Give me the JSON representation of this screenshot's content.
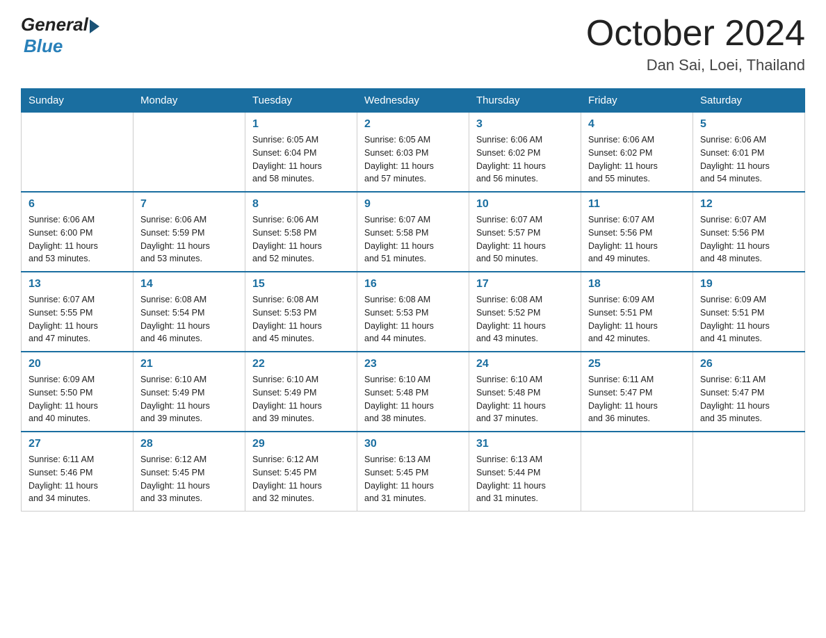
{
  "header": {
    "logo": {
      "general": "General",
      "blue": "Blue"
    },
    "title": "October 2024",
    "subtitle": "Dan Sai, Loei, Thailand"
  },
  "weekdays": [
    "Sunday",
    "Monday",
    "Tuesday",
    "Wednesday",
    "Thursday",
    "Friday",
    "Saturday"
  ],
  "weeks": [
    [
      {
        "day": "",
        "info": ""
      },
      {
        "day": "",
        "info": ""
      },
      {
        "day": "1",
        "info": "Sunrise: 6:05 AM\nSunset: 6:04 PM\nDaylight: 11 hours\nand 58 minutes."
      },
      {
        "day": "2",
        "info": "Sunrise: 6:05 AM\nSunset: 6:03 PM\nDaylight: 11 hours\nand 57 minutes."
      },
      {
        "day": "3",
        "info": "Sunrise: 6:06 AM\nSunset: 6:02 PM\nDaylight: 11 hours\nand 56 minutes."
      },
      {
        "day": "4",
        "info": "Sunrise: 6:06 AM\nSunset: 6:02 PM\nDaylight: 11 hours\nand 55 minutes."
      },
      {
        "day": "5",
        "info": "Sunrise: 6:06 AM\nSunset: 6:01 PM\nDaylight: 11 hours\nand 54 minutes."
      }
    ],
    [
      {
        "day": "6",
        "info": "Sunrise: 6:06 AM\nSunset: 6:00 PM\nDaylight: 11 hours\nand 53 minutes."
      },
      {
        "day": "7",
        "info": "Sunrise: 6:06 AM\nSunset: 5:59 PM\nDaylight: 11 hours\nand 53 minutes."
      },
      {
        "day": "8",
        "info": "Sunrise: 6:06 AM\nSunset: 5:58 PM\nDaylight: 11 hours\nand 52 minutes."
      },
      {
        "day": "9",
        "info": "Sunrise: 6:07 AM\nSunset: 5:58 PM\nDaylight: 11 hours\nand 51 minutes."
      },
      {
        "day": "10",
        "info": "Sunrise: 6:07 AM\nSunset: 5:57 PM\nDaylight: 11 hours\nand 50 minutes."
      },
      {
        "day": "11",
        "info": "Sunrise: 6:07 AM\nSunset: 5:56 PM\nDaylight: 11 hours\nand 49 minutes."
      },
      {
        "day": "12",
        "info": "Sunrise: 6:07 AM\nSunset: 5:56 PM\nDaylight: 11 hours\nand 48 minutes."
      }
    ],
    [
      {
        "day": "13",
        "info": "Sunrise: 6:07 AM\nSunset: 5:55 PM\nDaylight: 11 hours\nand 47 minutes."
      },
      {
        "day": "14",
        "info": "Sunrise: 6:08 AM\nSunset: 5:54 PM\nDaylight: 11 hours\nand 46 minutes."
      },
      {
        "day": "15",
        "info": "Sunrise: 6:08 AM\nSunset: 5:53 PM\nDaylight: 11 hours\nand 45 minutes."
      },
      {
        "day": "16",
        "info": "Sunrise: 6:08 AM\nSunset: 5:53 PM\nDaylight: 11 hours\nand 44 minutes."
      },
      {
        "day": "17",
        "info": "Sunrise: 6:08 AM\nSunset: 5:52 PM\nDaylight: 11 hours\nand 43 minutes."
      },
      {
        "day": "18",
        "info": "Sunrise: 6:09 AM\nSunset: 5:51 PM\nDaylight: 11 hours\nand 42 minutes."
      },
      {
        "day": "19",
        "info": "Sunrise: 6:09 AM\nSunset: 5:51 PM\nDaylight: 11 hours\nand 41 minutes."
      }
    ],
    [
      {
        "day": "20",
        "info": "Sunrise: 6:09 AM\nSunset: 5:50 PM\nDaylight: 11 hours\nand 40 minutes."
      },
      {
        "day": "21",
        "info": "Sunrise: 6:10 AM\nSunset: 5:49 PM\nDaylight: 11 hours\nand 39 minutes."
      },
      {
        "day": "22",
        "info": "Sunrise: 6:10 AM\nSunset: 5:49 PM\nDaylight: 11 hours\nand 39 minutes."
      },
      {
        "day": "23",
        "info": "Sunrise: 6:10 AM\nSunset: 5:48 PM\nDaylight: 11 hours\nand 38 minutes."
      },
      {
        "day": "24",
        "info": "Sunrise: 6:10 AM\nSunset: 5:48 PM\nDaylight: 11 hours\nand 37 minutes."
      },
      {
        "day": "25",
        "info": "Sunrise: 6:11 AM\nSunset: 5:47 PM\nDaylight: 11 hours\nand 36 minutes."
      },
      {
        "day": "26",
        "info": "Sunrise: 6:11 AM\nSunset: 5:47 PM\nDaylight: 11 hours\nand 35 minutes."
      }
    ],
    [
      {
        "day": "27",
        "info": "Sunrise: 6:11 AM\nSunset: 5:46 PM\nDaylight: 11 hours\nand 34 minutes."
      },
      {
        "day": "28",
        "info": "Sunrise: 6:12 AM\nSunset: 5:45 PM\nDaylight: 11 hours\nand 33 minutes."
      },
      {
        "day": "29",
        "info": "Sunrise: 6:12 AM\nSunset: 5:45 PM\nDaylight: 11 hours\nand 32 minutes."
      },
      {
        "day": "30",
        "info": "Sunrise: 6:13 AM\nSunset: 5:45 PM\nDaylight: 11 hours\nand 31 minutes."
      },
      {
        "day": "31",
        "info": "Sunrise: 6:13 AM\nSunset: 5:44 PM\nDaylight: 11 hours\nand 31 minutes."
      },
      {
        "day": "",
        "info": ""
      },
      {
        "day": "",
        "info": ""
      }
    ]
  ]
}
